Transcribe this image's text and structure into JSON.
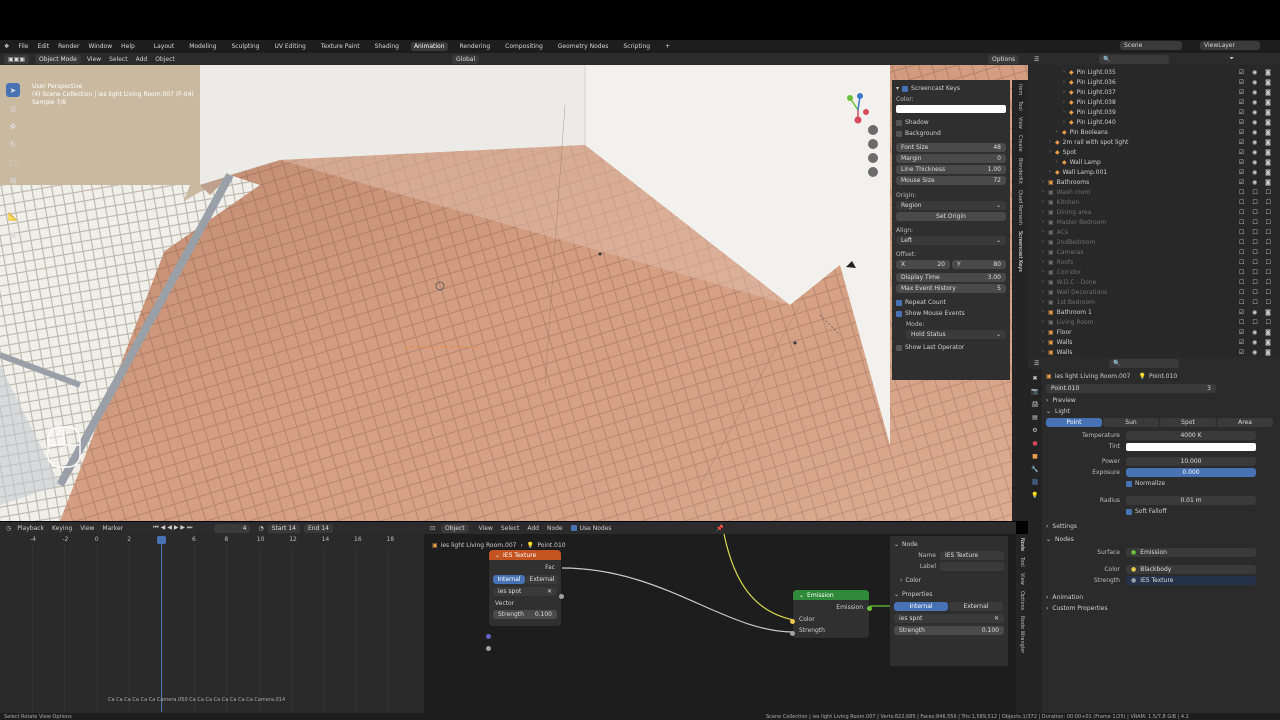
{
  "menu": [
    "File",
    "Edit",
    "Render",
    "Window",
    "Help"
  ],
  "workspaces": [
    "Layout",
    "Modeling",
    "Sculpting",
    "UV Editing",
    "Texture Paint",
    "Shading",
    "Animation",
    "Rendering",
    "Compositing",
    "Geometry Nodes",
    "Scripting"
  ],
  "active_workspace": "Animation",
  "scene": {
    "name": "Scene",
    "view_layer": "ViewLayer"
  },
  "viewport_header": {
    "mode": "Object Mode",
    "menus": [
      "View",
      "Select",
      "Add",
      "Object"
    ],
    "transform": "Global",
    "options": "Options"
  },
  "viewport_info": {
    "line1": "User Perspective",
    "line2": "(4) Scene Collection | ies light Living Room.007 (F-04)",
    "line3": "Sample 7/8"
  },
  "screencast": {
    "title": "Screencast Keys",
    "color_label": "Color:",
    "shadow": "Shadow",
    "background": "Background",
    "font_size_label": "Font Size",
    "font_size": "48",
    "margin_label": "Margin",
    "margin": "0",
    "line_thickness_label": "Line Thickness",
    "line_thickness": "1.00",
    "mouse_size_label": "Mouse Size",
    "mouse_size": "72",
    "origin_label": "Origin:",
    "origin": "Region",
    "set_origin": "Set Origin",
    "align_label": "Align:",
    "align": "Left",
    "offset_label": "Offset:",
    "offset_x_label": "X",
    "offset_x": "20",
    "offset_y_label": "Y",
    "offset_y": "80",
    "display_time_label": "Display Time",
    "display_time": "3.00",
    "max_history_label": "Max Event History",
    "max_history": "5",
    "repeat_count": "Repeat Count",
    "show_mouse": "Show Mouse Events",
    "mode_label": "Mode:",
    "mode": "Hold Status",
    "show_last": "Show Last Operator"
  },
  "side_tabs": [
    "Item",
    "Tool",
    "View",
    "Create",
    "BlenderKit",
    "Quad Remesh",
    "Screencast Keys"
  ],
  "outliner": [
    {
      "name": "Pin Light.035",
      "indent": 3,
      "dim": false
    },
    {
      "name": "Pin Light.036",
      "indent": 3,
      "dim": false
    },
    {
      "name": "Pin Light.037",
      "indent": 3,
      "dim": false
    },
    {
      "name": "Pin Light.038",
      "indent": 3,
      "dim": false
    },
    {
      "name": "Pin Light.039",
      "indent": 3,
      "dim": false
    },
    {
      "name": "Pin Light.040",
      "indent": 3,
      "dim": false
    },
    {
      "name": "Pin Booleans",
      "indent": 2,
      "dim": false
    },
    {
      "name": "2m rail with spot light",
      "indent": 1,
      "dim": false
    },
    {
      "name": "Spot",
      "indent": 1,
      "dim": false
    },
    {
      "name": "Wall Lamp",
      "indent": 2,
      "dim": false
    },
    {
      "name": "Wall Lamp.001",
      "indent": 1,
      "dim": false
    },
    {
      "name": "Bathrooms",
      "indent": 0,
      "dim": false
    },
    {
      "name": "Wash room",
      "indent": 0,
      "dim": true
    },
    {
      "name": "Kitchen",
      "indent": 0,
      "dim": true
    },
    {
      "name": "Dining area",
      "indent": 0,
      "dim": true
    },
    {
      "name": "Master Bedroom",
      "indent": 0,
      "dim": true
    },
    {
      "name": "ACs",
      "indent": 0,
      "dim": true
    },
    {
      "name": "2ndBedroom",
      "indent": 0,
      "dim": true
    },
    {
      "name": "Cameras",
      "indent": 0,
      "dim": true
    },
    {
      "name": "Roofs",
      "indent": 0,
      "dim": true
    },
    {
      "name": "Corridor",
      "indent": 0,
      "dim": true
    },
    {
      "name": "W.D.C - Done",
      "indent": 0,
      "dim": true
    },
    {
      "name": "Wall Decorations",
      "indent": 0,
      "dim": true
    },
    {
      "name": "1st Bedroom",
      "indent": 0,
      "dim": true
    },
    {
      "name": "Bathroom 1",
      "indent": 0,
      "dim": false
    },
    {
      "name": "Living Room",
      "indent": 0,
      "dim": true
    },
    {
      "name": "Floor",
      "indent": 0,
      "dim": false
    },
    {
      "name": "Walls",
      "indent": 0,
      "dim": false
    },
    {
      "name": "Walls",
      "indent": 0,
      "dim": false
    }
  ],
  "properties": {
    "object": "ies light Living Room.007",
    "data": "Point.010",
    "data_field": "Point.010",
    "users": "3",
    "preview": "Preview",
    "light": "Light",
    "types": [
      "Point",
      "Sun",
      "Spot",
      "Area"
    ],
    "active_type": "Point",
    "temperature_label": "Temperature",
    "temperature": "4000 K",
    "tint_label": "Tint",
    "power_label": "Power",
    "power": "10.000",
    "exposure_label": "Exposure",
    "exposure": "0.000",
    "normalize": "Normalize",
    "radius_label": "Radius",
    "radius": "0.01 m",
    "soft_falloff": "Soft Falloff",
    "settings": "Settings",
    "nodes": "Nodes",
    "surface_label": "Surface",
    "surface": "Emission",
    "color_label": "Color",
    "color": "Blackbody",
    "strength_label": "Strength",
    "strength": "IES Texture",
    "animation": "Animation",
    "custom": "Custom Properties"
  },
  "timeline": {
    "menus": [
      "Playback",
      "Keying",
      "View",
      "Marker"
    ],
    "frame": "4",
    "start_label": "Start",
    "start": "14",
    "end_label": "End",
    "end": "14",
    "ticks": [
      "-4",
      "-2",
      "0",
      "2",
      "4",
      "6",
      "8",
      "10",
      "12",
      "14",
      "16",
      "18"
    ],
    "camera_labels": "Ca Ca Ca Ca Ca Ca Camera.050 Ca Ca Ca Ca Ca Ca Ca Ca Camera.014"
  },
  "node_editor": {
    "type": "Object",
    "menus": [
      "View",
      "Select",
      "Add",
      "Node"
    ],
    "use_nodes": "Use Nodes",
    "breadcrumb_obj": "ies light Living Room.007",
    "breadcrumb_data": "Point.010",
    "ies_title": "IES Texture",
    "fac": "Fac",
    "internal": "Internal",
    "external": "External",
    "file": "ies spot",
    "vector": "Vector",
    "strength_label": "Strength",
    "strength": "0.100",
    "emission_title": "Emission",
    "emission_out": "Emission",
    "color": "Color",
    "strength_in": "Strength"
  },
  "node_panel": {
    "title": "Node",
    "name_label": "Name",
    "name": "IES Texture",
    "label_label": "Label",
    "color": "Color",
    "properties": "Properties",
    "internal": "Internal",
    "external": "External",
    "file": "ies spot",
    "strength_label": "Strength",
    "strength": "0.100"
  },
  "node_tabs": [
    "Node",
    "Tool",
    "View",
    "Options",
    "Node Wrangler"
  ],
  "status": {
    "left": "Select   Rotate View   Options",
    "right": "Scene Collection | ies light Living Room.007 | Verts:822,685 | Faces:846,556 | Tris:1,589,512 | Objects:1/372 | Duration: 00:00+01 (Frame 1/25) | VRAM: 1.5/7.8 GiB | 4.2"
  },
  "colors": {
    "accent": "#4772b3",
    "wall": "#e6e2dc",
    "floor": "#d9a083"
  }
}
